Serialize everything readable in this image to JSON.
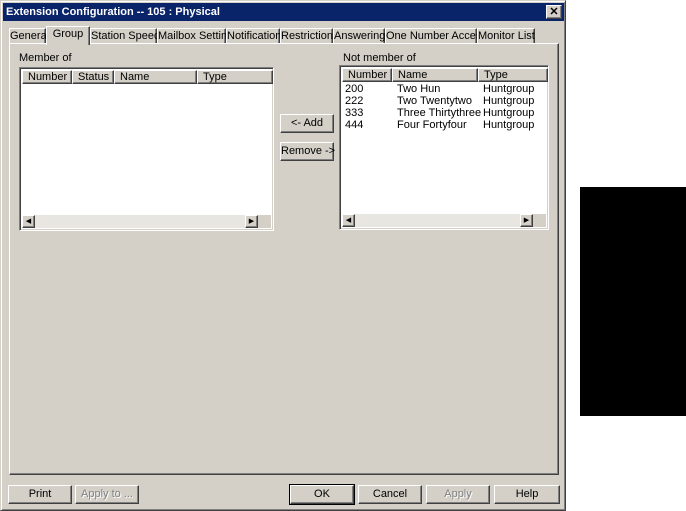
{
  "window": {
    "title": "Extension Configuration -- 105 : Physical",
    "close_glyph": "✕"
  },
  "tabs": [
    {
      "label": "General"
    },
    {
      "label": "Group",
      "active": true
    },
    {
      "label": "Station Speed"
    },
    {
      "label": "Mailbox Setting"
    },
    {
      "label": "Notification"
    },
    {
      "label": "Restriction"
    },
    {
      "label": "Answering"
    },
    {
      "label": "One Number Access"
    },
    {
      "label": "Monitor List"
    }
  ],
  "member_of": {
    "label": "Member of",
    "columns": [
      "Number",
      "Status",
      "Name",
      "Type"
    ],
    "rows": []
  },
  "not_member_of": {
    "label": "Not member of",
    "columns": [
      "Number",
      "Name",
      "Type"
    ],
    "rows": [
      {
        "number": "200",
        "name": "Two Hun",
        "type": "Huntgroup"
      },
      {
        "number": "222",
        "name": "Two Twentytwo",
        "type": "Huntgroup"
      },
      {
        "number": "333",
        "name": "Three Thirtythree",
        "type": "Huntgroup"
      },
      {
        "number": "444",
        "name": "Four Fortyfour",
        "type": "Huntgroup"
      }
    ]
  },
  "middle_buttons": {
    "add": "<- Add",
    "remove": "Remove ->"
  },
  "bottom_buttons": {
    "print": "Print",
    "apply_to": "Apply to ...",
    "ok": "OK",
    "cancel": "Cancel",
    "apply": "Apply",
    "help": "Help"
  },
  "scroll_glyphs": {
    "left": "◀",
    "right": "▶"
  }
}
